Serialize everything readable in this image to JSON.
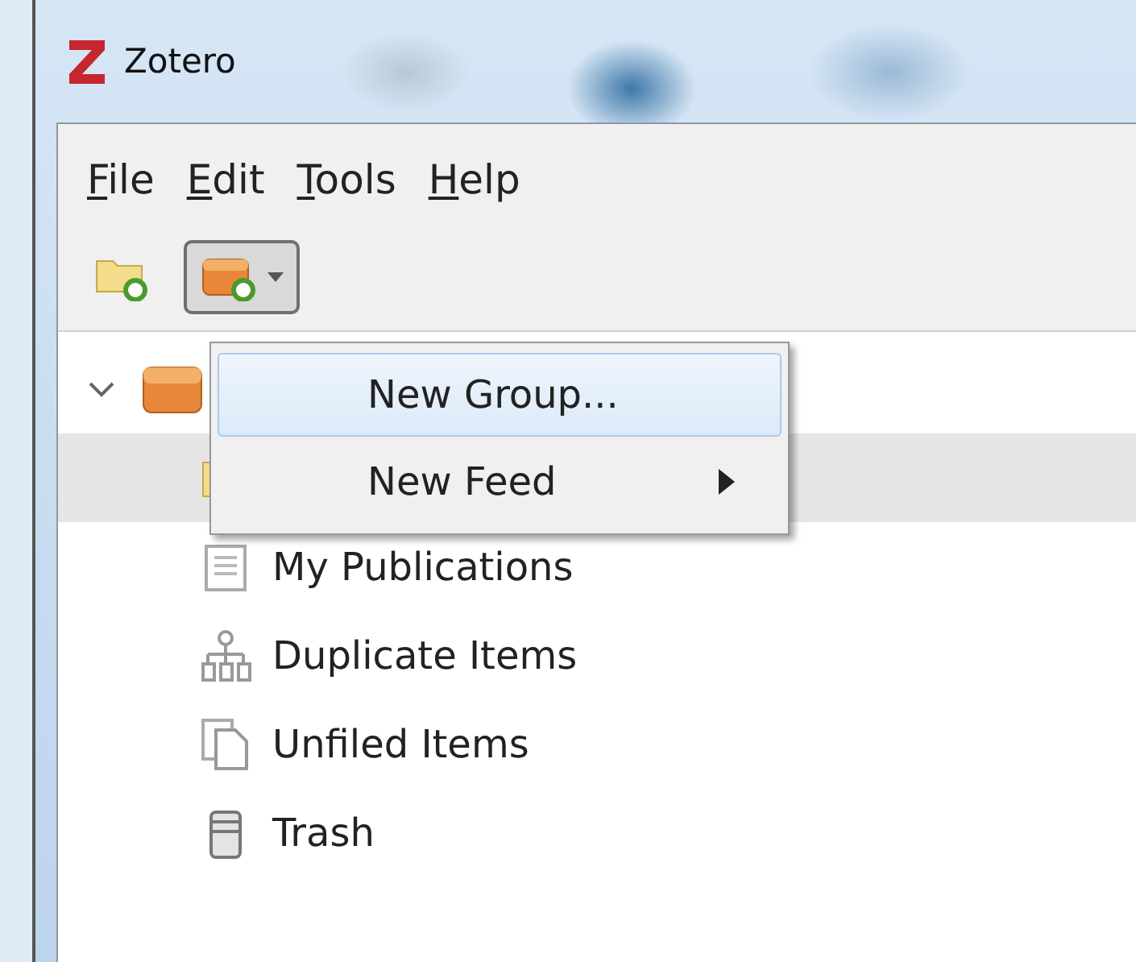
{
  "window": {
    "title": "Zotero"
  },
  "menubar": [
    {
      "label": "File"
    },
    {
      "label": "Edit"
    },
    {
      "label": "Tools"
    },
    {
      "label": "Help"
    }
  ],
  "toolbar": [
    {
      "kind": "new-collection"
    },
    {
      "kind": "new-library",
      "open": true
    }
  ],
  "tree": [
    {
      "kind": "library",
      "expanded": true,
      "selected": false,
      "children": [
        {
          "kind": "folder",
          "selected": true
        },
        {
          "kind": "publications",
          "label": "My Publications",
          "selected": false
        },
        {
          "kind": "duplicates",
          "label": "Duplicate Items",
          "selected": false
        },
        {
          "kind": "unfiled",
          "label": "Unfiled Items",
          "selected": false
        },
        {
          "kind": "trash",
          "label": "Trash",
          "selected": false
        }
      ]
    }
  ],
  "popup_menu": {
    "items": [
      {
        "label": "New Group...",
        "selected": true,
        "submenu": false
      },
      {
        "label": "New Feed",
        "selected": false,
        "submenu": true
      }
    ]
  }
}
